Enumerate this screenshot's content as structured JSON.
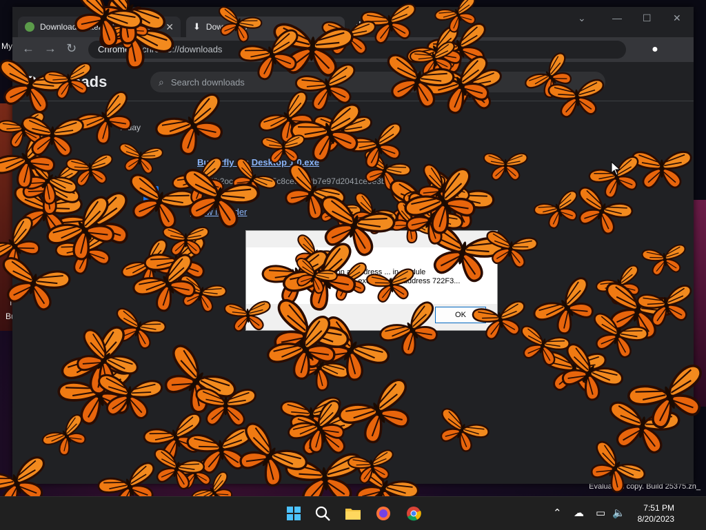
{
  "desktop": {
    "label_my": "My",
    "label_i": "I",
    "label_bu": "Bu",
    "watermark": "Evaluation copy. Build 25375.zn_"
  },
  "browser": {
    "tabs": [
      {
        "title": "Download Butterfly On Desktop",
        "active": false
      },
      {
        "title": "Downloads",
        "active": true
      }
    ],
    "new_tab_label": "+",
    "omnibox_chip": "Chrome",
    "omnibox_text": "chrome://downloads",
    "page_title": "Downloads",
    "search_placeholder": "Search downloads",
    "date_label": "Today",
    "download": {
      "file_name": "Butterfly On Desktop 1.0.exe",
      "url": "https://h2ocdn.../32/2a5c8ce3a59b7e97d2041ce9e3b3...",
      "show_in_folder": "Show in folder"
    }
  },
  "dialog": {
    "message_line1": "Access violation at address ... in module",
    "message_line2": "ButterflyOnDesktop.exe. Read of address 722F3...",
    "ok_label": "OK"
  },
  "taskbar": {
    "time": "7:51 PM",
    "date": "8/20/2023"
  },
  "colors": {
    "butterfly_orange": "#f07a12",
    "butterfly_dark": "#2a0c02",
    "link_blue": "#8ab4f8"
  }
}
